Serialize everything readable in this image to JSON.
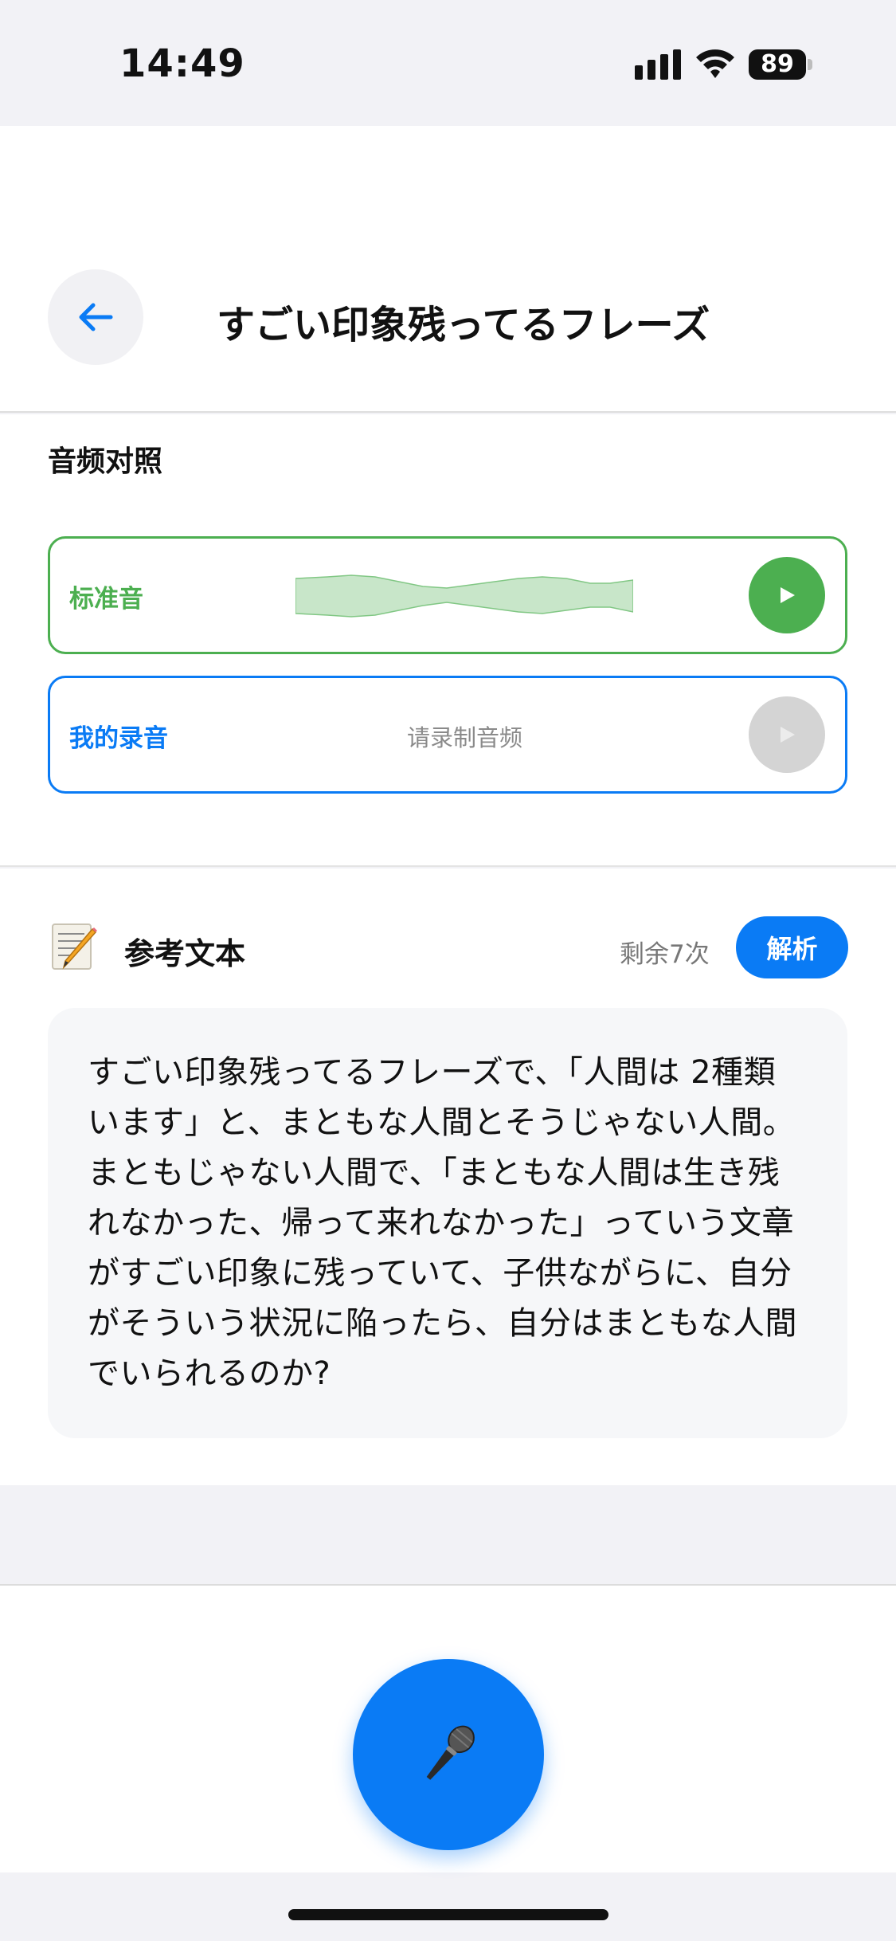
{
  "status_bar": {
    "time": "14:49",
    "battery": "89"
  },
  "header": {
    "title": "すごい印象残ってるフレーズ"
  },
  "audio_compare": {
    "section_title": "音频对照",
    "standard": {
      "label": "标准音"
    },
    "mine": {
      "label": "我的录音",
      "placeholder": "请录制音频"
    }
  },
  "reference": {
    "title": "参考文本",
    "remaining": "剩余7次",
    "analyze_label": "解析",
    "text": "すごい印象残ってるフレーズで、「人間は 2種類います」と、まともな人間とそうじゃない人間。まともじゃない人間で、「まともな人間は生き残れなかった、帰って来れなかった」っていう文章がすごい印象に残っていて、子供ながらに、自分がそういう状況に陥ったら、自分はまともな人間でいられるのか?"
  },
  "icons": {
    "back": "arrow-left-icon",
    "play": "play-icon",
    "memo": "memo-icon",
    "record": "microphone-icon"
  },
  "colors": {
    "accent_blue": "#0a7bf5",
    "standard_green": "#4caf50",
    "disabled_gray": "#d4d4d4"
  }
}
